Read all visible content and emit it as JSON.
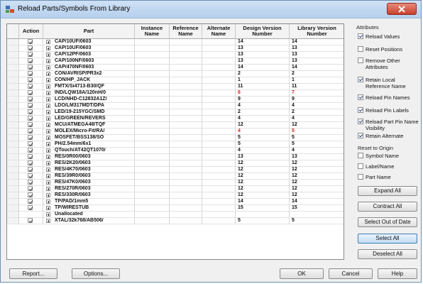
{
  "window": {
    "title": "Reload Parts/Symbols From Library",
    "close_label": "x"
  },
  "table": {
    "headers": [
      "Action",
      "Part",
      "Instance Name",
      "Reference Name",
      "Alternate Name",
      "Design Version Number",
      "Library Version Number"
    ],
    "rows": [
      {
        "checked": true,
        "part": "CAP/10UF/0603",
        "design": "14",
        "library": "14",
        "changed": false
      },
      {
        "checked": true,
        "part": "CAP/10UF/0603",
        "design": "13",
        "library": "13",
        "changed": false
      },
      {
        "checked": true,
        "part": "CAP/12PF/0603",
        "design": "13",
        "library": "13",
        "changed": false
      },
      {
        "checked": true,
        "part": "CAP/100NF/0603",
        "design": "13",
        "library": "13",
        "changed": false
      },
      {
        "checked": true,
        "part": "CAP/470NF/0603",
        "design": "14",
        "library": "14",
        "changed": false
      },
      {
        "checked": true,
        "part": "CON/AVRISP/PR3x2",
        "design": "2",
        "library": "2",
        "changed": false
      },
      {
        "checked": true,
        "part": "CON/HP_JACK",
        "design": "1",
        "library": "1",
        "changed": false
      },
      {
        "checked": true,
        "part": "FMTX/Si4713-B30/QF",
        "design": "11",
        "library": "11",
        "changed": false
      },
      {
        "checked": true,
        "part": "IND/LQW18A/120nH/0",
        "design": "6",
        "library": "7",
        "changed": true
      },
      {
        "checked": true,
        "part": "LCD/NHD-C12832A1Z/",
        "design": "9",
        "library": "9",
        "changed": false
      },
      {
        "checked": true,
        "part": "LDO/LM317MDT/DPA",
        "design": "4",
        "library": "4",
        "changed": false
      },
      {
        "checked": true,
        "part": "LED/19-215YGC/SMD",
        "design": "2",
        "library": "2",
        "changed": false
      },
      {
        "checked": true,
        "part": "LED/GREEN/REVERS",
        "design": "4",
        "library": "4",
        "changed": false
      },
      {
        "checked": true,
        "part": "MCU/ATMEGA48/TQF",
        "design": "12",
        "library": "12",
        "changed": false
      },
      {
        "checked": true,
        "part": "MOLEX/Micro-Fit/RA/",
        "design": "4",
        "library": "5",
        "changed": true
      },
      {
        "checked": true,
        "part": "MOSFET/BSS138/SO",
        "design": "5",
        "library": "5",
        "changed": false
      },
      {
        "checked": true,
        "part": "PH/2.54mm/6x1",
        "design": "5",
        "library": "5",
        "changed": false
      },
      {
        "checked": true,
        "part": "QTouch/AT42QT1070/",
        "design": "4",
        "library": "4",
        "changed": false
      },
      {
        "checked": true,
        "part": "RES/0R00/0603",
        "design": "13",
        "library": "13",
        "changed": false
      },
      {
        "checked": true,
        "part": "RES/2K20/0603",
        "design": "12",
        "library": "12",
        "changed": false
      },
      {
        "checked": true,
        "part": "RES/4K70/0603",
        "design": "12",
        "library": "12",
        "changed": false
      },
      {
        "checked": true,
        "part": "RES/39R0/0603",
        "design": "12",
        "library": "12",
        "changed": false
      },
      {
        "checked": true,
        "part": "RES/47K0/0603",
        "design": "12",
        "library": "12",
        "changed": false
      },
      {
        "checked": true,
        "part": "RES/270R/0603",
        "design": "12",
        "library": "12",
        "changed": false
      },
      {
        "checked": true,
        "part": "RES/330R/0603",
        "design": "12",
        "library": "12",
        "changed": false
      },
      {
        "checked": true,
        "part": "TP/PAD/1mm5",
        "design": "14",
        "library": "14",
        "changed": false
      },
      {
        "checked": true,
        "part": "TP/WIRESTUB",
        "design": "15",
        "library": "15",
        "changed": false
      },
      {
        "checked": false,
        "part": "Unallocated",
        "design": "",
        "library": "",
        "changed": false
      },
      {
        "checked": true,
        "part": "XTAL/32k768/AB506/",
        "design": "5",
        "library": "5",
        "changed": false
      }
    ]
  },
  "attributes": {
    "group_label": "Attributes",
    "options": [
      {
        "label": "Reload Values",
        "checked": true
      },
      {
        "label": "Reset Positions",
        "checked": false
      },
      {
        "label": "Remove Other Attributes",
        "checked": false
      },
      {
        "label": "Retain Local Reference Name",
        "checked": true
      },
      {
        "label": "Reload Pin Names",
        "checked": true
      },
      {
        "label": "Reload Pin Labels",
        "checked": true
      },
      {
        "label": "Reload Part Pin Name Visibility",
        "checked": true
      },
      {
        "label": "Retain Alternate",
        "checked": true
      }
    ]
  },
  "reset_to_origin": {
    "group_label": "Reset to Origin",
    "options": [
      {
        "label": "Symbol Name",
        "checked": false
      },
      {
        "label": "Label/Name",
        "checked": false
      },
      {
        "label": "Part Name",
        "checked": false
      }
    ]
  },
  "side_buttons": [
    "Expand All",
    "Contract All",
    "Select Out of Date",
    "Select All",
    "Deselect All"
  ],
  "bottom_buttons": {
    "report": "Report...",
    "options": "Options...",
    "ok": "OK",
    "cancel": "Cancel",
    "help": "Help"
  },
  "colors": {
    "changed_value": "#e02020",
    "focus_button": "#c4ddf6"
  }
}
